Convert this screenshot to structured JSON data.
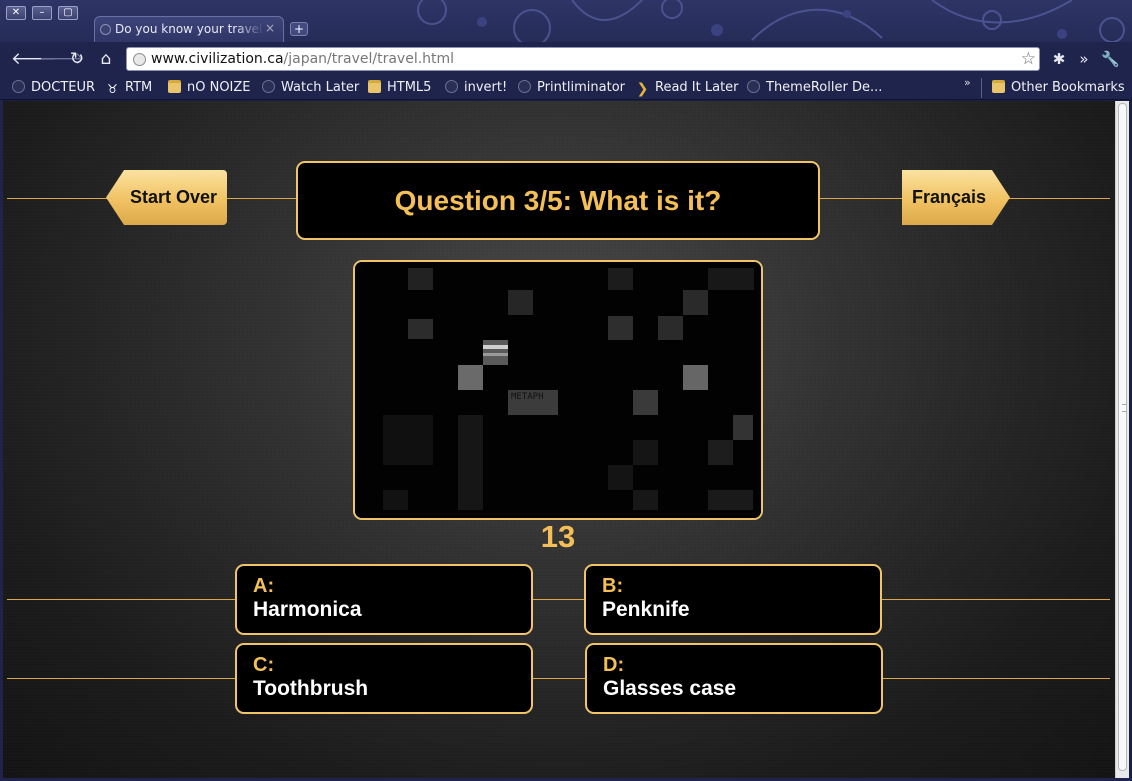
{
  "window": {
    "controls": [
      "close",
      "minimize",
      "maximize"
    ],
    "tab_title": "Do you know your travel gadgets",
    "tab_close": "×",
    "new_tab": "+"
  },
  "toolbar": {
    "url_host": "www.civilization.ca",
    "url_path": "/japan/travel/travel.html",
    "icons": [
      "back-icon",
      "forward-icon",
      "reload-icon",
      "home-icon",
      "star-icon",
      "extension-icon",
      "extension-more-icon",
      "wrench-icon"
    ]
  },
  "bookmarks": {
    "items": [
      {
        "label": "DOCTEUR",
        "icon": "globe"
      },
      {
        "label": "RTM",
        "icon": "rtm"
      },
      {
        "label": "nO NOIZE",
        "icon": "folder"
      },
      {
        "label": "Watch Later",
        "icon": "globe"
      },
      {
        "label": "HTML5",
        "icon": "folder"
      },
      {
        "label": "invert!",
        "icon": "globe"
      },
      {
        "label": "Printliminator",
        "icon": "globe"
      },
      {
        "label": "Read It Later",
        "icon": "chevron"
      },
      {
        "label": "ThemeRoller De...",
        "icon": "globe"
      }
    ],
    "overflow": "»",
    "other": "Other Bookmarks"
  },
  "quiz": {
    "start_over": "Start Over",
    "language": "Français",
    "question": "Question 3/5: What is it?",
    "counter": "13",
    "photo_text": "МЕТАРН",
    "answers": [
      {
        "letter": "A:",
        "text": "Harmonica"
      },
      {
        "letter": "B:",
        "text": "Penknife"
      },
      {
        "letter": "C:",
        "text": "Toothbrush"
      },
      {
        "letter": "D:",
        "text": "Glasses case"
      }
    ]
  },
  "colors": {
    "accent_gold": "#f5bf58",
    "panel_border": "#f1c46a",
    "chrome": "#1f244c"
  }
}
